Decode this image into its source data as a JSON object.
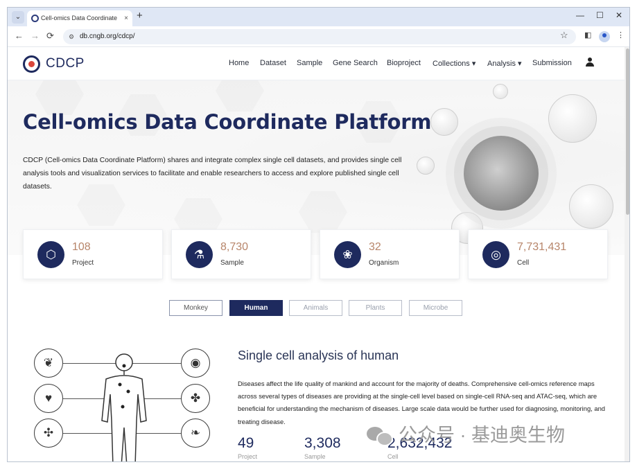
{
  "browser": {
    "tab_title": "Cell-omics Data Coordinate",
    "tab_close": "×",
    "new_tab": "+",
    "url": "db.cngb.org/cdcp/",
    "controls": {
      "minimize": "—",
      "maximize": "☐",
      "close": "✕"
    },
    "nav": {
      "back": "←",
      "forward": "→",
      "reload": "⟳"
    },
    "icons": {
      "tab_list": "chevron-down-icon",
      "site_settings": "tune-icon",
      "bookmark": "star-icon",
      "side_panel": "side-panel-icon",
      "profile": "profile-icon"
    }
  },
  "header": {
    "brand": "CDCP",
    "nav_items": [
      {
        "label": "Home"
      },
      {
        "label": "Dataset"
      },
      {
        "label": "Sample"
      },
      {
        "label": "Gene Search"
      },
      {
        "label": "Bioproject"
      },
      {
        "label": "Collections ▾"
      },
      {
        "label": "Analysis ▾"
      },
      {
        "label": "Submission"
      }
    ]
  },
  "hero": {
    "title": "Cell-omics Data Coordinate Platform",
    "description": "CDCP (Cell-omics Data Coordinate Platform) shares and integrate complex single cell datasets, and provides single cell analysis tools and visualization services to facilitate and enable researchers to access and explore published single cell datasets."
  },
  "stats": [
    {
      "value": "108",
      "label": "Project",
      "icon": "box-icon",
      "glyph": "⬡"
    },
    {
      "value": "8,730",
      "label": "Sample",
      "icon": "flask-icon",
      "glyph": "⚗"
    },
    {
      "value": "32",
      "label": "Organism",
      "icon": "paw-icon",
      "glyph": "❀"
    },
    {
      "value": "7,731,431",
      "label": "Cell",
      "icon": "cell-icon",
      "glyph": "◎"
    }
  ],
  "species_tabs": [
    {
      "label": "Monkey"
    },
    {
      "label": "Human",
      "active": true
    },
    {
      "label": "Animals"
    },
    {
      "label": "Plants"
    },
    {
      "label": "Microbe"
    }
  ],
  "section": {
    "title": "Single cell analysis of human",
    "text": "Diseases affect the life quality of mankind and account for the majority of deaths. Comprehensive cell-omics reference maps across several types of diseases are providing at the single-cell level based on single-cell RNA-seq and ATAC-seq, which are beneficial for understanding the mechanism of diseases. Large scale data would be further used for diagnosing, monitoring, and treating disease.",
    "numbers": [
      {
        "value": "49",
        "label": "Project"
      },
      {
        "value": "3,308",
        "label": "Sample"
      },
      {
        "value": "2,632,432",
        "label": "Cell"
      }
    ]
  },
  "organs": [
    {
      "icon": "brain-icon",
      "glyph": "❦"
    },
    {
      "icon": "heart-icon",
      "glyph": "♥"
    },
    {
      "icon": "vessel-icon",
      "glyph": "✣"
    },
    {
      "icon": "eye-icon",
      "glyph": "◉"
    },
    {
      "icon": "lung-icon",
      "glyph": "✤"
    },
    {
      "icon": "kidney-icon",
      "glyph": "❧"
    }
  ],
  "watermark": "公众号 · 基迪奥生物"
}
